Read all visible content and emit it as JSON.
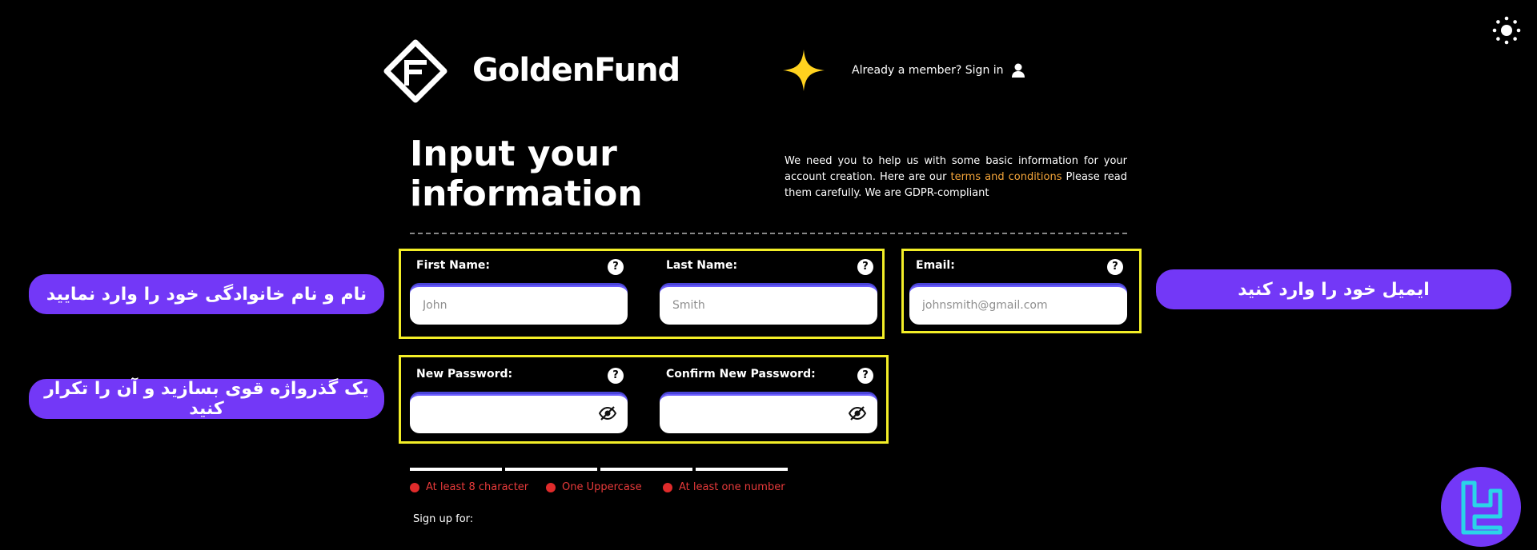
{
  "header": {
    "brand": "GoldenFund",
    "member_text": "Already a member? Sign in",
    "icons": {
      "logo": "goldenfund-logo-icon",
      "sparkle": "sparkle-icon",
      "user": "user-icon",
      "theme": "sun-icon"
    },
    "colors": {
      "sparkle": "#ffd21f"
    }
  },
  "heading": {
    "title_line1": "Input your",
    "title_line2": "information",
    "intro_before": "We need you to help us with some basic information for your account creation. Here are our ",
    "intro_link": "terms and conditions",
    "intro_after": " Please read them carefully. We are GDPR-compliant"
  },
  "form": {
    "first_name": {
      "label": "First Name:",
      "placeholder": "John",
      "value": ""
    },
    "last_name": {
      "label": "Last Name:",
      "placeholder": "Smith",
      "value": ""
    },
    "email": {
      "label": "Email:",
      "placeholder": "johnsmith@gmail.com",
      "value": ""
    },
    "new_password": {
      "label": "New Password:",
      "value": ""
    },
    "confirm_password": {
      "label": "Confirm New Password:",
      "value": ""
    },
    "help_glyph": "?",
    "rules": [
      "At least 8 character",
      "One Uppercase",
      "At least one number"
    ],
    "signup_label": "Sign up for:"
  },
  "annotations": {
    "names": "نام و نام خانوادگی خود را وارد نمایید",
    "email": "ایمیل خود را وارد کنید",
    "password": "یک گذرواژه قوی بسازید و آن را تکرار کنید",
    "colors": {
      "pill": "#7338f7",
      "frame": "#f3ee27"
    }
  }
}
